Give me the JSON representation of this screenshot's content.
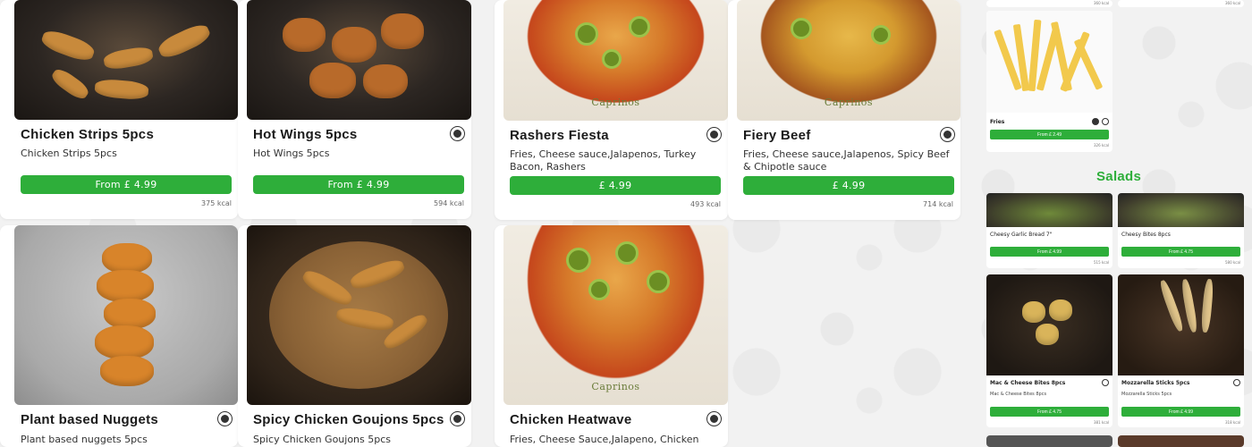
{
  "colors": {
    "accent": "#2eae3a",
    "section": "#2eae3a"
  },
  "items": [
    {
      "title": "Chicken Strips 5pcs",
      "desc": "Chicken Strips 5pcs",
      "price": "From £ 4.99",
      "kcal": "375 kcal",
      "diet_icon": ""
    },
    {
      "title": "Hot Wings 5pcs",
      "desc": "Hot Wings 5pcs",
      "price": "From £ 4.99",
      "kcal": "594 kcal",
      "diet_icon": "non-veg-icon"
    },
    {
      "title": "Rashers Fiesta",
      "desc": "Fries, Cheese sauce,Jalapenos, Turkey Bacon, Rashers",
      "price": "£ 4.99",
      "kcal": "493 kcal",
      "diet_icon": "non-veg-icon"
    },
    {
      "title": "Fiery Beef",
      "desc": "Fries, Cheese sauce,Jalapenos, Spicy Beef & Chipotle sauce",
      "price": "£ 4.99",
      "kcal": "714 kcal",
      "diet_icon": "non-veg-icon"
    },
    {
      "title": "Plant based Nuggets",
      "desc": "Plant based nuggets 5pcs",
      "diet_icon": "veg-icon"
    },
    {
      "title": "Spicy Chicken Goujons 5pcs",
      "desc": "Spicy Chicken Goujons 5pcs",
      "diet_icon": "non-veg-icon"
    },
    {
      "title": "Chicken Heatwave",
      "desc": "Fries, Cheese Sauce,Jalapeno, Chicken Strips,",
      "diet_icon": "non-veg-icon"
    }
  ],
  "sidebar": {
    "top_kcal_left": "360 kcal",
    "top_kcal_right": "360 kcal",
    "fries": {
      "title": "Fries",
      "price": "From £ 2.49",
      "kcal": "326 kcal"
    },
    "section_title": "Salads",
    "minis": [
      {
        "title": "Cheesy Garlic Bread 7\"",
        "price": "From £ 4.99",
        "kcal": "515 kcal"
      },
      {
        "title": "Cheesy Bites 8pcs",
        "price": "From £ 4.75",
        "kcal": "580 kcal"
      },
      {
        "title": "Mac & Cheese Bites 8pcs",
        "desc": "Mac & Cheese Bites 8pcs",
        "price": "From £ 4.75",
        "kcal": "381 kcal"
      },
      {
        "title": "Mozzarella Sticks 5pcs",
        "desc": "Mozzarella Sticks 5pcs",
        "price": "From £ 4.99",
        "kcal": "318 kcal"
      }
    ]
  }
}
